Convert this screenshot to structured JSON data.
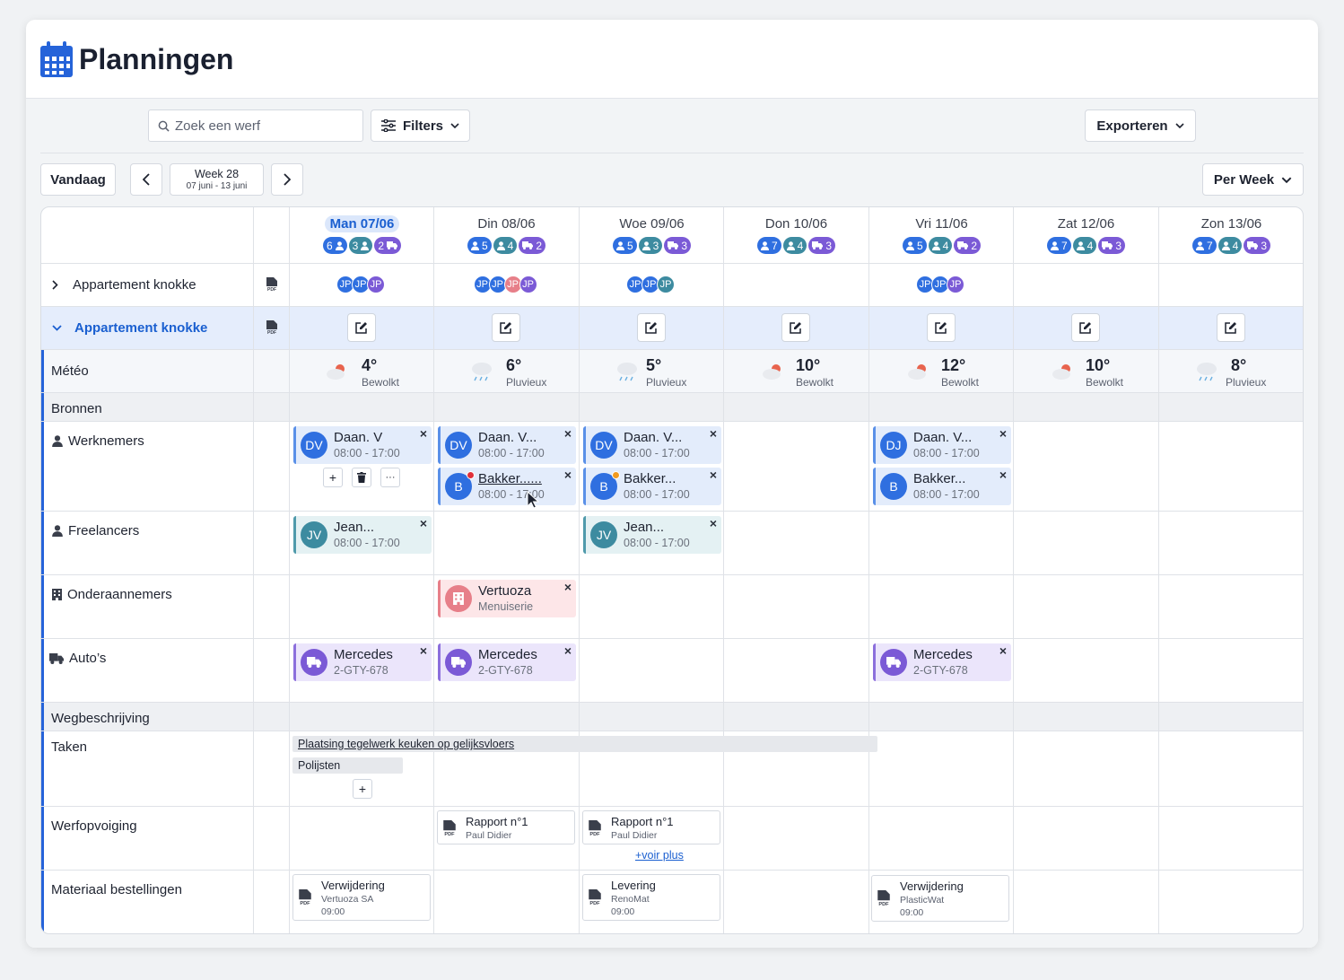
{
  "header": {
    "title": "Planningen"
  },
  "toolbar": {
    "search_placeholder": "Zoek een werf",
    "filters": "Filters",
    "export": "Exporteren"
  },
  "nav": {
    "today": "Vandaag",
    "week_label": "Week 28",
    "week_range": "07 juni - 13 juni",
    "view": "Per Week"
  },
  "days": [
    {
      "label": "Man 07/06",
      "today": true,
      "counts": [
        "6",
        "3",
        "2"
      ]
    },
    {
      "label": "Din 08/06",
      "counts": [
        "5",
        "4",
        "2"
      ]
    },
    {
      "label": "Woe 09/06",
      "counts": [
        "5",
        "3",
        "3"
      ]
    },
    {
      "label": "Don 10/06",
      "counts": [
        "7",
        "4",
        "3"
      ]
    },
    {
      "label": "Vri 11/06",
      "counts": [
        "5",
        "4",
        "2"
      ]
    },
    {
      "label": "Zat 12/06",
      "counts": [
        "7",
        "4",
        "3"
      ]
    },
    {
      "label": "Zon 13/06",
      "counts": [
        "7",
        "4",
        "3"
      ]
    }
  ],
  "projects": [
    {
      "name": "Appartement knokke"
    },
    {
      "name": "Appartement knokke"
    }
  ],
  "avatars": {
    "initials": "JP"
  },
  "rows": {
    "meteo": "Météo",
    "bronnen": "Bronnen",
    "werknemers": "Werknemers",
    "freelancers": "Freelancers",
    "onderaannemers": "Onderaannemers",
    "autos": "Auto’s",
    "wegbeschrijving": "Wegbeschrijving",
    "taken": "Taken",
    "werfopvolging": "Werfopvoiging",
    "materiaal": "Materiaal bestellingen"
  },
  "weather": [
    {
      "temp": "4°",
      "desc": "Bewolkt"
    },
    {
      "temp": "6°",
      "desc": "Pluvieux"
    },
    {
      "temp": "5°",
      "desc": "Pluvieux"
    },
    {
      "temp": "10°",
      "desc": "Bewolkt"
    },
    {
      "temp": "12°",
      "desc": "Bewolkt"
    },
    {
      "temp": "10°",
      "desc": "Bewolkt"
    },
    {
      "temp": "8°",
      "desc": "Pluvieux"
    }
  ],
  "werknemers": {
    "d0a": {
      "init": "DV",
      "name": "Daan. V",
      "hours": "08:00 - 17:00"
    },
    "d1a": {
      "init": "DV",
      "name": "Daan. V...",
      "hours": "08:00 - 17:00"
    },
    "d1b": {
      "init": "B",
      "name": "Bakker......",
      "hours": "08:00 - 17:00"
    },
    "d2a": {
      "init": "DV",
      "name": "Daan. V...",
      "hours": "08:00 - 17:00"
    },
    "d2b": {
      "init": "B",
      "name": "Bakker...",
      "hours": "08:00 - 17:00"
    },
    "d4a": {
      "init": "DJ",
      "name": "Daan. V...",
      "hours": "08:00 - 17:00"
    },
    "d4b": {
      "init": "B",
      "name": "Bakker...",
      "hours": "08:00 - 17:00"
    }
  },
  "freelancers": {
    "d0": {
      "init": "JV",
      "name": "Jean...",
      "hours": "08:00 - 17:00"
    },
    "d2": {
      "init": "JV",
      "name": "Jean...",
      "hours": "08:00 - 17:00"
    }
  },
  "sub": {
    "name": "Vertuoza",
    "type": "Menuiserie"
  },
  "car": {
    "name": "Mercedes",
    "plate": "2-GTY-678"
  },
  "tasks": {
    "t1": "Plaatsing tegelwerk keuken op gelijksvloers",
    "t2": "Polijsten"
  },
  "reports": {
    "title": "Rapport n°1",
    "author": "Paul Didier",
    "more": "+voir plus"
  },
  "orders": [
    {
      "title": "Verwijdering",
      "vendor": "Vertuoza SA",
      "time": "09:00"
    },
    {
      "title": "Levering",
      "vendor": "RenoMat",
      "time": "09:00"
    },
    {
      "title": "Verwijdering",
      "vendor": "PlasticWat",
      "time": "09:00"
    }
  ],
  "close": "×",
  "plus": "+",
  "dots": "···",
  "colors": {
    "primary": "#2563d9",
    "employee": "#2f6fe0",
    "freelancer": "#3d8ba0",
    "car": "#7b5ad6",
    "sub": "#e77f89"
  }
}
